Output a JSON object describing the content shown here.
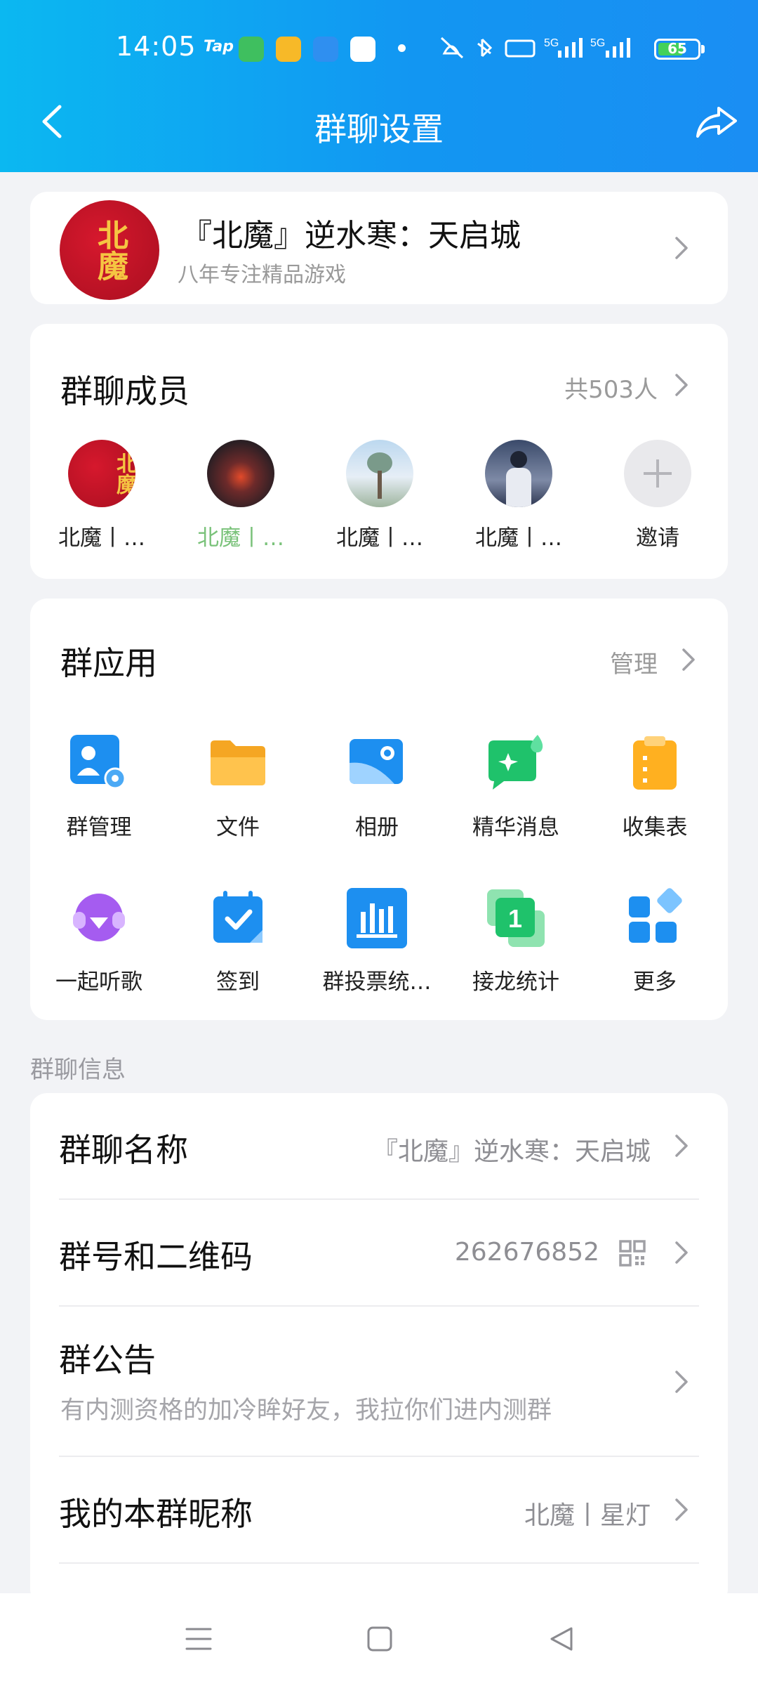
{
  "status": {
    "time": "14:05",
    "tap_label": "Tap",
    "battery": "65",
    "battery_level": 0.65
  },
  "nav": {
    "title": "群聊设置"
  },
  "group": {
    "name": "『北魔』逆水寒：天启城",
    "subtitle": "八年专注精品游戏",
    "logo_text": "北魔"
  },
  "members": {
    "title": "群聊成员",
    "count": "共503人",
    "items": [
      {
        "name": "北魔丨…"
      },
      {
        "name": "北魔丨…"
      },
      {
        "name": "北魔丨…"
      },
      {
        "name": "北魔丨…"
      },
      {
        "name": "邀请"
      }
    ]
  },
  "apps": {
    "title": "群应用",
    "manage": "管理",
    "items": [
      {
        "label": "群管理",
        "icon": "group-manage-icon"
      },
      {
        "label": "文件",
        "icon": "folder-icon"
      },
      {
        "label": "相册",
        "icon": "album-icon"
      },
      {
        "label": "精华消息",
        "icon": "essence-message-icon"
      },
      {
        "label": "收集表",
        "icon": "clipboard-icon"
      },
      {
        "label": "一起听歌",
        "icon": "listen-together-icon"
      },
      {
        "label": "签到",
        "icon": "checkin-calendar-icon"
      },
      {
        "label": "群投票统…",
        "icon": "vote-chart-icon"
      },
      {
        "label": "接龙统计",
        "icon": "relay-icon"
      },
      {
        "label": "更多",
        "icon": "more-grid-icon"
      }
    ]
  },
  "info": {
    "caption": "群聊信息",
    "name_label": "群聊名称",
    "name_value": "『北魔』逆水寒：天启城",
    "id_label": "群号和二维码",
    "id_value": "262676852",
    "notice_label": "群公告",
    "notice_value": "有内测资格的加冷眸好友，我拉你们进内测群",
    "nickname_label": "我的本群昵称",
    "nickname_value": "北魔丨星灯"
  },
  "colors": {
    "header_start": "#0bb8f1",
    "header_end": "#1a8ef3",
    "accent": "#1296f2"
  }
}
